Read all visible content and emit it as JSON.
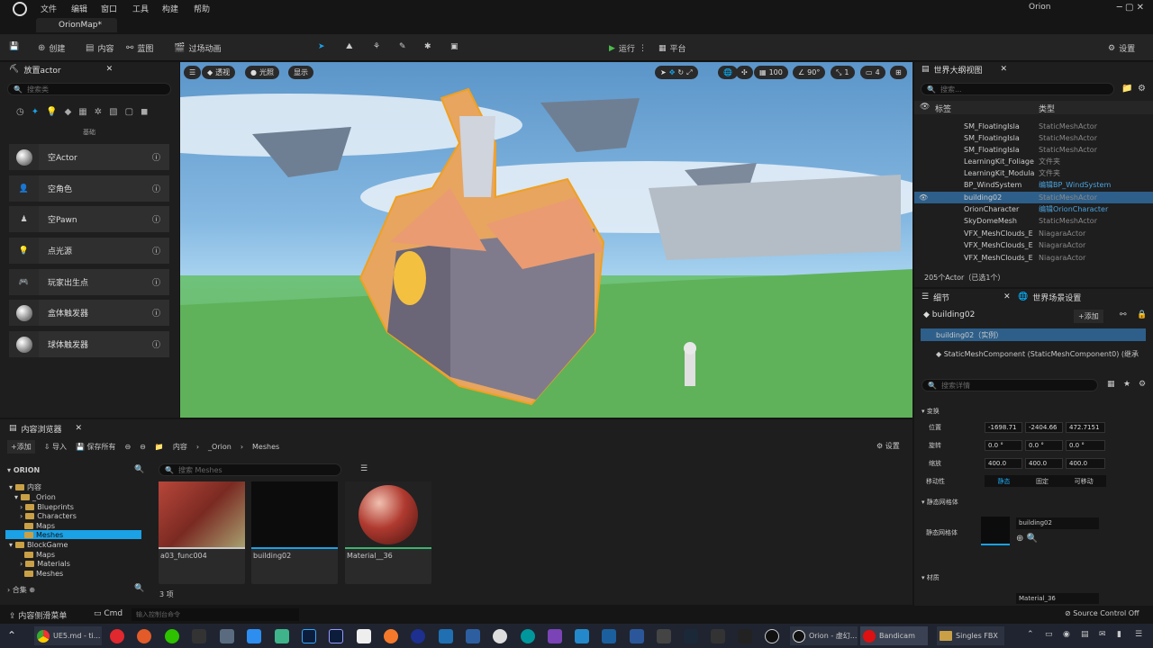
{
  "menu": {
    "file": "文件",
    "edit": "编辑",
    "window": "窗口",
    "tools": "工具",
    "build": "构建",
    "help": "帮助",
    "project": "Orion"
  },
  "tab": {
    "map": "OrionMap*"
  },
  "window_controls": "─   ▢   ✕",
  "toolbar": {
    "create": "创建",
    "content": "内容",
    "blueprint": "蓝图",
    "cinematics": "过场动画",
    "run": "运行",
    "platform": "平台",
    "settings": "设置"
  },
  "place_actors": {
    "title": "放置actor",
    "search": "搜索类",
    "category": "基础",
    "items": [
      {
        "label": "空Actor"
      },
      {
        "label": "空角色"
      },
      {
        "label": "空Pawn"
      },
      {
        "label": "点光源"
      },
      {
        "label": "玩家出生点"
      },
      {
        "label": "盒体触发器"
      },
      {
        "label": "球体触发器"
      }
    ]
  },
  "viewport": {
    "perspective": "透视",
    "lit": "光照",
    "show": "显示",
    "fov": "90°",
    "speed": "100",
    "cam": "1",
    "layout": "4"
  },
  "outliner": {
    "title": "世界大纲视图",
    "search": "搜索...",
    "col_label": "标签",
    "col_type": "类型",
    "rows": [
      {
        "name": "SM_FloatingIsla",
        "type": "StaticMeshActor"
      },
      {
        "name": "SM_FloatingIsla",
        "type": "StaticMeshActor"
      },
      {
        "name": "SM_FloatingIsla",
        "type": "StaticMeshActor"
      },
      {
        "name": "LearningKit_Foliage",
        "type": "文件夹"
      },
      {
        "name": "LearningKit_Modula",
        "type": "文件夹"
      },
      {
        "name": "BP_WindSystem",
        "type": "编辑BP_WindSystem"
      },
      {
        "name": "building02",
        "type": "StaticMeshActor"
      },
      {
        "name": "OrionCharacter",
        "type": "编辑OrionCharacter"
      },
      {
        "name": "SkyDomeMesh",
        "type": "StaticMeshActor"
      },
      {
        "name": "VFX_MeshClouds_E",
        "type": "NiagaraActor"
      },
      {
        "name": "VFX_MeshClouds_E",
        "type": "NiagaraActor"
      },
      {
        "name": "VFX_MeshClouds_E",
        "type": "NiagaraActor"
      }
    ],
    "count": "205个Actor（已选1个）"
  },
  "details": {
    "tab": "细节",
    "tab2": "世界场景设置",
    "object": "building02",
    "add": "+添加",
    "instance": "building02（实例）",
    "component": "StaticMeshComponent (StaticMeshComponent0) (继承",
    "search": "搜索详情",
    "transform": "变换",
    "location": "位置",
    "rotation": "旋转",
    "scale": "缩放",
    "loc": [
      "-1698.71",
      "-2404.66",
      "472.7151"
    ],
    "rot": [
      "0.0 °",
      "0.0 °",
      "0.0 °"
    ],
    "scl": [
      "400.0",
      "400.0",
      "400.0"
    ],
    "mobility": "移动性",
    "mob_static": "静态",
    "mob_fixed": "固定",
    "mob_movable": "可移动",
    "static_mesh_section": "静态网格体",
    "static_mesh": "静态网格体",
    "mesh_value": "building02",
    "materials": "材质",
    "material_value": "Material_36"
  },
  "content_browser": {
    "title": "内容浏览器",
    "add": "添加",
    "import": "导入",
    "save_all": "保存所有",
    "path": [
      "内容",
      "_Orion",
      "Meshes"
    ],
    "settings": "设置",
    "root": "ORION",
    "search": "搜索 Meshes",
    "tree": [
      "内容",
      "_Orion",
      "Blueprints",
      "Characters",
      "Maps",
      "Meshes",
      "BlockGame",
      "Maps",
      "Materials",
      "Meshes"
    ],
    "collections": "合集",
    "assets": [
      {
        "name": "a03_func004"
      },
      {
        "name": "building02"
      },
      {
        "name": "Material__36"
      }
    ],
    "count": "3 项"
  },
  "status": {
    "drawer": "内容侧滑菜单",
    "cmd": "Cmd",
    "console": "输入控制台命令",
    "source": "Source Control Off"
  },
  "taskbar": {
    "ue5": "UE5.md - ti...",
    "orion": "Orion - 虚幻...",
    "bandicam": "Bandicam",
    "singles": "Singles FBX"
  },
  "colors": {
    "accent": "#1aa1e6",
    "selected": "#2d5f8a",
    "gold": "#f0a020"
  }
}
